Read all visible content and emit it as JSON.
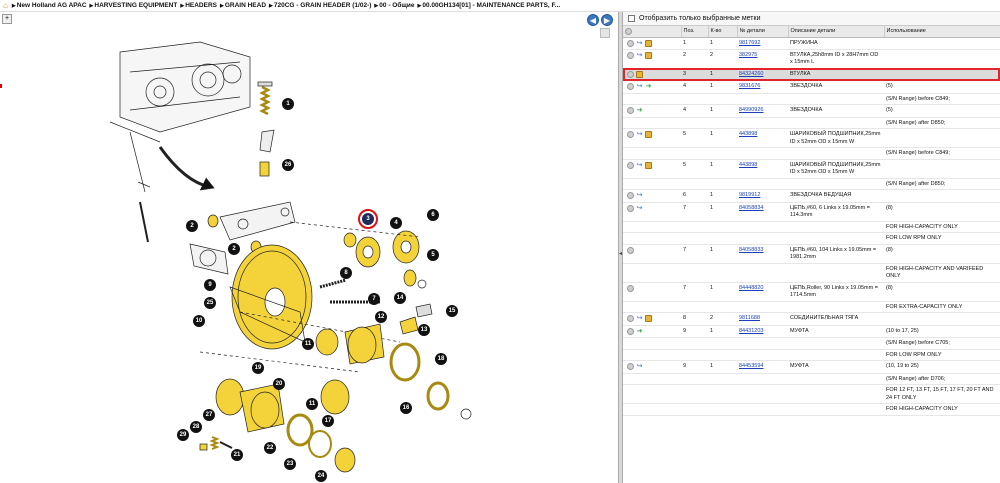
{
  "breadcrumbs": [
    "New Holland AG APAC",
    "HARVESTING EQUIPMENT",
    "HEADERS",
    "GRAIN HEAD",
    "720CG - GRAIN HEADER (1/02-)",
    "00 - Общие",
    "00.00GH134[01] - MAINTENANCE PARTS, F..."
  ],
  "filter_label": "Отобразить только выбранные метки",
  "columns": [
    "Поз.",
    "К-во",
    "№ детали",
    "Описание детали",
    "Использование"
  ],
  "rows": [
    {
      "icons": [
        "grey",
        "blue",
        "box"
      ],
      "pos": "1",
      "qty": "1",
      "part": "9817692",
      "desc": "ПРУЖИНА",
      "usage": ""
    },
    {
      "icons": [
        "grey",
        "blue",
        "box"
      ],
      "pos": "2",
      "qty": "2",
      "part": "382975",
      "desc": "ВТУЛКА,25h8mm ID x 28H7mm OD x 15mm L",
      "usage": ""
    },
    {
      "icons": [
        "grey",
        "box"
      ],
      "pos": "3",
      "qty": "1",
      "part": "84324260",
      "desc": "ВТУЛКА",
      "usage": "",
      "highlight": true
    },
    {
      "icons": [
        "grey",
        "blue",
        "green"
      ],
      "pos": "4",
      "qty": "1",
      "part": "9831676",
      "desc": "ЗВЕЗДОЧКА",
      "usage": "(5)"
    },
    {
      "icons": [],
      "pos": "",
      "qty": "",
      "part": "",
      "desc": "",
      "usage": "(S/N Range) before C849;"
    },
    {
      "icons": [
        "grey",
        "green"
      ],
      "pos": "4",
      "qty": "1",
      "part": "84990926",
      "desc": "ЗВЕЗДОЧКА",
      "usage": "(5)"
    },
    {
      "icons": [],
      "pos": "",
      "qty": "",
      "part": "",
      "desc": "",
      "usage": "(S/N Range) after D850;"
    },
    {
      "icons": [
        "grey",
        "blue",
        "box"
      ],
      "pos": "5",
      "qty": "1",
      "part": "443898",
      "desc": "ШАРИКОВЫЙ ПОДШИПНИК,25mm ID x 52mm OD x 15mm W",
      "usage": ""
    },
    {
      "icons": [],
      "pos": "",
      "qty": "",
      "part": "",
      "desc": "",
      "usage": "(S/N Range) before C849;"
    },
    {
      "icons": [
        "grey",
        "blue",
        "box"
      ],
      "pos": "5",
      "qty": "1",
      "part": "443898",
      "desc": "ШАРИКОВЫЙ ПОДШИПНИК,25mm ID x 52mm OD x 15mm W",
      "usage": ""
    },
    {
      "icons": [],
      "pos": "",
      "qty": "",
      "part": "",
      "desc": "",
      "usage": "(S/N Range) after D850;"
    },
    {
      "icons": [
        "grey",
        "blue"
      ],
      "pos": "6",
      "qty": "1",
      "part": "9819912",
      "desc": "ЗВЕЗДОЧКА ВЕДУЩАЯ",
      "usage": ""
    },
    {
      "icons": [
        "grey",
        "blue"
      ],
      "pos": "7",
      "qty": "1",
      "part": "84058834",
      "desc": "ЦЕПЬ,#60, 6 Links x 19.05mm = 114.3mm",
      "usage": "(8)"
    },
    {
      "icons": [],
      "pos": "",
      "qty": "",
      "part": "",
      "desc": "",
      "usage": "FOR HIGH-CAPACITY ONLY"
    },
    {
      "icons": [],
      "pos": "",
      "qty": "",
      "part": "",
      "desc": "",
      "usage": "FOR LOW RPM ONLY"
    },
    {
      "icons": [
        "grey"
      ],
      "pos": "7",
      "qty": "1",
      "part": "84058833",
      "desc": "ЦЕПЬ,#60, 104 Links x 19.05mm = 1981.2mm",
      "usage": "(8)"
    },
    {
      "icons": [],
      "pos": "",
      "qty": "",
      "part": "",
      "desc": "",
      "usage": "FOR HIGH-CAPACITY AND VARIFEED ONLY"
    },
    {
      "icons": [
        "grey"
      ],
      "pos": "7",
      "qty": "1",
      "part": "84448820",
      "desc": "ЦЕПЬ,Roller, 90 Links x 19.05mm = 1714.5mm",
      "usage": "(8)"
    },
    {
      "icons": [],
      "pos": "",
      "qty": "",
      "part": "",
      "desc": "",
      "usage": "FOR EXTRA-CAPACITY ONLY"
    },
    {
      "icons": [
        "grey",
        "blue",
        "box"
      ],
      "pos": "8",
      "qty": "2",
      "part": "9811688",
      "desc": "СОЕДИНИТЕЛЬНАЯ ТЯГА",
      "usage": ""
    },
    {
      "icons": [
        "grey",
        "green"
      ],
      "pos": "9",
      "qty": "1",
      "part": "84431203",
      "desc": "МУФТА",
      "usage": "(10 to 17, 25)"
    },
    {
      "icons": [],
      "pos": "",
      "qty": "",
      "part": "",
      "desc": "",
      "usage": "(S/N Range) before C705;"
    },
    {
      "icons": [],
      "pos": "",
      "qty": "",
      "part": "",
      "desc": "",
      "usage": "FOR LOW RPM ONLY"
    },
    {
      "icons": [
        "grey",
        "blue"
      ],
      "pos": "9",
      "qty": "1",
      "part": "84453594",
      "desc": "МУФТА",
      "usage": "(10, 19 to 25)"
    },
    {
      "icons": [],
      "pos": "",
      "qty": "",
      "part": "",
      "desc": "",
      "usage": "(S/N Range) after D706;"
    },
    {
      "icons": [],
      "pos": "",
      "qty": "",
      "part": "",
      "desc": "",
      "usage": "FOR 12 FT, 13 FT, 15 FT, 17 FT, 20 FT AND 24 FT ONLY"
    },
    {
      "icons": [],
      "pos": "",
      "qty": "",
      "part": "",
      "desc": "",
      "usage": "FOR HIGH-CAPACITY ONLY"
    }
  ],
  "callouts": [
    "1",
    "26",
    "2",
    "2",
    "3",
    "4",
    "6",
    "5",
    "8",
    "7",
    "9",
    "25",
    "10",
    "14",
    "15",
    "13",
    "11",
    "12",
    "18",
    "19",
    "20",
    "11",
    "17",
    "16",
    "27",
    "28",
    "29",
    "21",
    "22",
    "23",
    "24"
  ],
  "selected_callout": "3",
  "colors": {
    "highlight_border": "#e0262c",
    "link": "#1a3fb6",
    "part_yellow": "#f3d23a",
    "nav_blue": "#3b78c2"
  }
}
